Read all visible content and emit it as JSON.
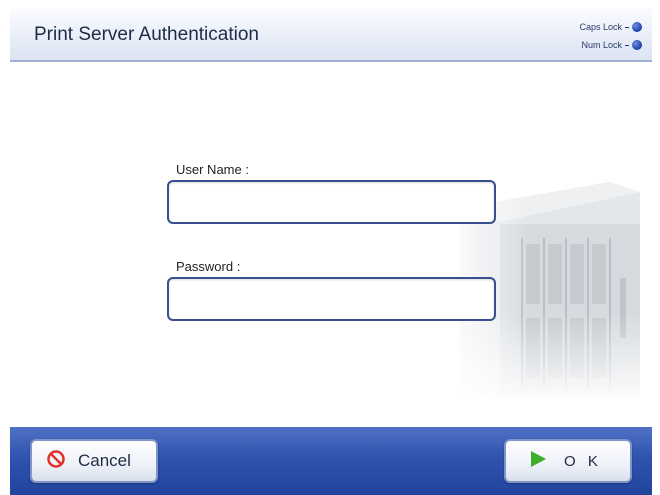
{
  "header": {
    "title": "Print Server Authentication",
    "caps_lock_label": "Caps Lock",
    "num_lock_label": "Num Lock"
  },
  "form": {
    "user_name_label": "User Name :",
    "user_name_value": "",
    "password_label": "Password :",
    "password_value": ""
  },
  "footer": {
    "cancel_label": "Cancel",
    "ok_label": "O K"
  },
  "colors": {
    "accent": "#2f53ae",
    "field_border": "#3a4e92",
    "indicator": "#1d3fa8",
    "cancel_icon": "#e0302a",
    "ok_icon": "#3cae2c"
  },
  "icons": {
    "cancel": "prohibit-icon",
    "ok": "play-arrow-icon",
    "indicator": "led-dot-icon",
    "decoration": "server-rack-icon"
  }
}
